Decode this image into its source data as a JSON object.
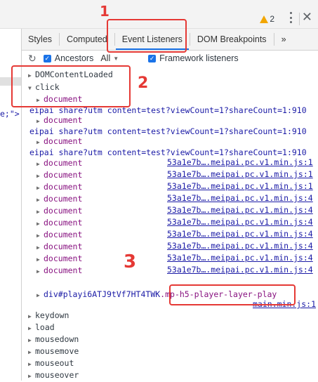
{
  "header": {
    "warning_count": "2",
    "close_symbol": "✕"
  },
  "left_pane": {
    "snippet": "e;\">"
  },
  "tabs": [
    {
      "label": "Styles"
    },
    {
      "label": "Computed"
    },
    {
      "label": "Event Listeners"
    },
    {
      "label": "DOM Breakpoints"
    },
    {
      "label": "»"
    }
  ],
  "toolbar": {
    "refresh_icon": "↻",
    "ancestors_label": "Ancestors",
    "filter_value": "All",
    "framework_label": "Framework listeners"
  },
  "events": {
    "domcontentloaded": "DOMContentLoaded",
    "click": "click",
    "document": "document",
    "urls": [
      "eipai share?utm content=test?viewCount=1?shareCount=1:910",
      "eipai share?utm content=test?viewCount=1?shareCount=1:910",
      "eipai share?utm content=test?viewCount=1?shareCount=1:910"
    ],
    "listeners": [
      {
        "node": "document",
        "file": "53a1e7b….meipai.pc.v1.min.js:1"
      },
      {
        "node": "document",
        "file": "53a1e7b….meipai.pc.v1.min.js:1"
      },
      {
        "node": "document",
        "file": "53a1e7b….meipai.pc.v1.min.js:1"
      },
      {
        "node": "document",
        "file": "53a1e7b….meipai.pc.v1.min.js:4"
      },
      {
        "node": "document",
        "file": "53a1e7b….meipai.pc.v1.min.js:4"
      },
      {
        "node": "document",
        "file": "53a1e7b….meipai.pc.v1.min.js:4"
      },
      {
        "node": "document",
        "file": "53a1e7b….meipai.pc.v1.min.js:4"
      },
      {
        "node": "document",
        "file": "53a1e7b….meipai.pc.v1.min.js:4"
      },
      {
        "node": "document",
        "file": "53a1e7b….meipai.pc.v1.min.js:4"
      },
      {
        "node": "document",
        "file": "53a1e7b….meipai.pc.v1.min.js:4"
      }
    ],
    "div_id": "div#playi6ATJ9tVf7HT4TWK",
    "div_class": ".mp-h5-player-layer-play",
    "div_file": "main.min.js:1",
    "others": [
      "keydown",
      "load",
      "mousedown",
      "mousemove",
      "mouseout",
      "mouseover"
    ]
  },
  "annotations": {
    "one": "1",
    "two": "2",
    "three": "3"
  },
  "colors": {
    "accent": "#1a73e8",
    "annotation": "#e53935",
    "warning": "#f2a600"
  }
}
